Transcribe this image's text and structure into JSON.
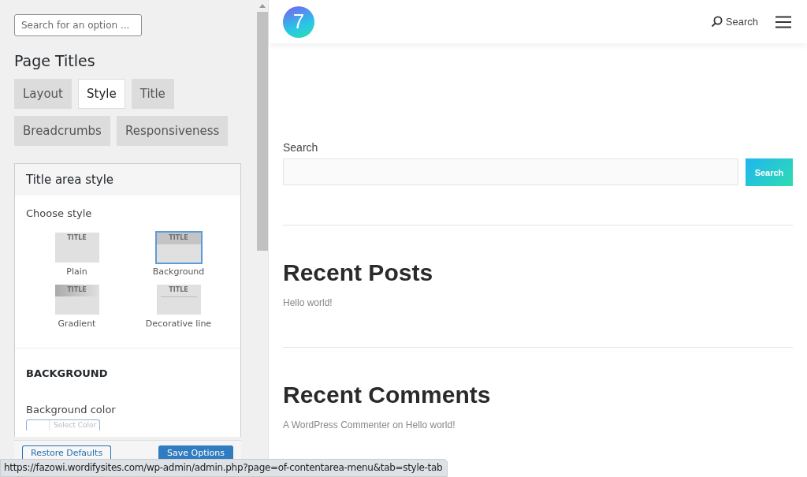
{
  "options_panel": {
    "search": {
      "placeholder": "Search for an option ..."
    },
    "heading": "Page Titles",
    "tabs": [
      {
        "label": "Layout",
        "selected": false
      },
      {
        "label": "Style",
        "selected": true
      },
      {
        "label": "Title",
        "selected": false
      },
      {
        "label": "Breadcrumbs",
        "selected": false
      },
      {
        "label": "Responsiveness",
        "selected": false
      }
    ],
    "card": {
      "title": "Title area style",
      "field_label": "Choose style",
      "styles": [
        {
          "label": "Plain",
          "kind": "plain",
          "thumb_text": "TITLE",
          "selected": false
        },
        {
          "label": "Background",
          "kind": "background",
          "thumb_text": "TITLE",
          "selected": true
        },
        {
          "label": "Gradient",
          "kind": "gradient",
          "thumb_text": "TITLE",
          "selected": false
        },
        {
          "label": "Decorative line",
          "kind": "decorative",
          "thumb_text": "TITLE",
          "selected": false
        }
      ],
      "section": "BACKGROUND",
      "color_label": "Background color",
      "color_placeholder": "Select Color"
    },
    "footer": {
      "buttons": [
        {
          "label": "Restore Defaults",
          "kind": "secondary"
        },
        {
          "label": "Save Options",
          "kind": "primary"
        }
      ]
    }
  },
  "preview": {
    "logo": "7",
    "header_search": "Search",
    "search_widget": {
      "label": "Search",
      "button": "Search"
    },
    "recent_posts": {
      "title": "Recent Posts",
      "items": [
        "Hello world!"
      ]
    },
    "recent_comments": {
      "title": "Recent Comments",
      "items": [
        {
          "author": "A WordPress Commenter",
          "connector": "on",
          "post": "Hello world!"
        }
      ]
    }
  },
  "status_bar": "https://fazowi.wordifysites.com/wp-admin/admin.php?page=of-contentarea-menu&tab=style-tab"
}
